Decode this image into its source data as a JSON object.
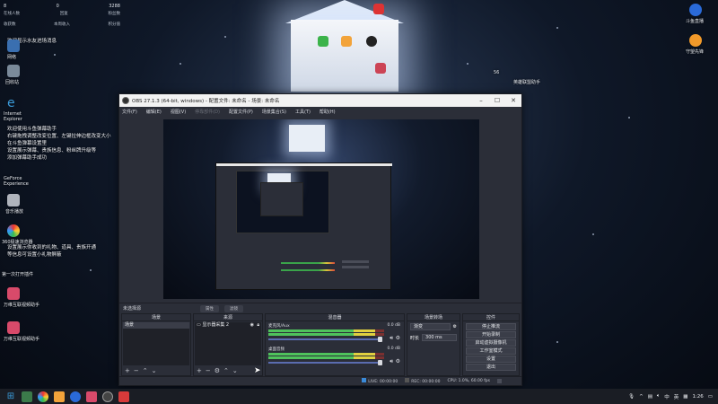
{
  "desktop": {
    "widget": {
      "stats": [
        "8",
        "0",
        "3288"
      ],
      "stat_labels": [
        "在线人数",
        "回复",
        "粉丝数"
      ],
      "bottom_labels": [
        "收获数",
        "本周收入",
        "积分值"
      ]
    },
    "info_line_top": "欢迎显示水友进场消息",
    "icons_left": [
      {
        "label": "网络"
      },
      {
        "label": "回收站"
      },
      {
        "label": "Internet Explorer"
      },
      {
        "label": "GeForce Experience"
      },
      {
        "label": "音乐播放"
      },
      {
        "label": "360极速浏览器"
      },
      {
        "label": "第一次打开插件"
      },
      {
        "label": "万维互联视频助手"
      },
      {
        "label": "万维互联视频助手"
      }
    ],
    "info_block": [
      "欢迎使用斗鱼弹幕助手",
      "右键拖拽调整改变位置、左键拉伸边框改变大小",
      "在斗鱼弹幕设置里",
      "设置展示弹幕、贵族信息、粉丝牌升级等",
      "添加弹幕助手成功"
    ],
    "info_block2": [
      "设置展示你收到的礼物、道具、贵族开通",
      "等信息可设置小礼物屏蔽"
    ],
    "icons_right": [
      {
        "label": "斗鱼直播"
      },
      {
        "label": "守望先锋"
      },
      {
        "label": "56"
      },
      {
        "label": "英雄联盟助手"
      }
    ]
  },
  "obs": {
    "title": "OBS 27.1.3 (64-bit, windows) - 配置文件: 未命名 - 场景: 未命名",
    "menu": [
      "文件(F)",
      "编辑(E)",
      "视图(V)",
      "停靠部件(D)",
      "配置文件(P)",
      "场景集合(S)",
      "工具(T)",
      "帮助(H)"
    ],
    "mode_bar": {
      "scene_label": "未选择源",
      "tabs": [
        "属性",
        "滤镜"
      ]
    },
    "docks": {
      "scenes": {
        "header": "场景",
        "items": [
          "场景"
        ]
      },
      "sources": {
        "header": "来源",
        "items": [
          "显示器采集 2"
        ]
      },
      "mixer": {
        "header": "混音器",
        "tracks": [
          {
            "name": "麦克风/Aux",
            "db": "0.0 dB",
            "level": 0.92
          },
          {
            "name": "桌面音频",
            "db": "0.0 dB",
            "level": 0.92
          }
        ]
      },
      "transitions": {
        "header": "场景转场",
        "type": "渐变",
        "duration_label": "时长",
        "duration": "300 ms"
      },
      "controls": {
        "header": "控件",
        "buttons": [
          "停止推流",
          "开始录制",
          "启动虚拟摄像机",
          "工作室模式",
          "设置",
          "退出"
        ]
      }
    },
    "status": {
      "live": "LIVE: 00:00:00",
      "rec": "REC: 00:00:00",
      "cpu": "CPU: 1.0%, 60.00 fps"
    }
  },
  "taskbar": {
    "tray_lang": "中",
    "tray_lang2": "英",
    "time": "1:26"
  }
}
